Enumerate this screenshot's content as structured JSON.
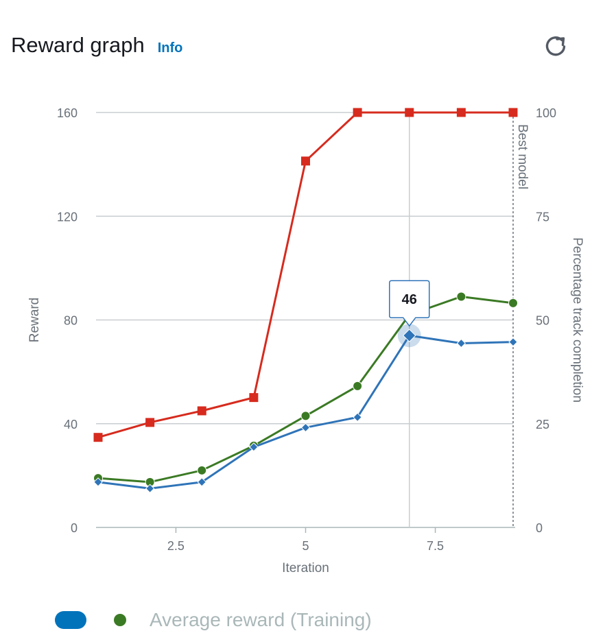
{
  "header": {
    "title": "Reward graph",
    "info_label": "Info",
    "refresh_icon": "refresh-icon"
  },
  "legend": {
    "series_label": "Average reward (Training)"
  },
  "chart_data": {
    "type": "line",
    "xlabel": "Iteration",
    "ylabel": "Reward",
    "ylabel_right": "Percentage track completion",
    "x_ticks": [
      "2.5",
      "5",
      "7.5"
    ],
    "y_ticks": [
      "0",
      "40",
      "80",
      "120",
      "160"
    ],
    "y_right_ticks": [
      "0",
      "25",
      "50",
      "75",
      "100"
    ],
    "xlim": [
      1,
      9
    ],
    "ylim": [
      0,
      160
    ],
    "ylim_right": [
      0,
      100
    ],
    "grid": true,
    "x": [
      1,
      2,
      3,
      4,
      5,
      6,
      7,
      8,
      9
    ],
    "series": [
      {
        "name": "Average reward (Training)",
        "axis": "left",
        "marker": "circle",
        "color": "#3b7a24",
        "values": [
          19,
          17.5,
          22,
          31.5,
          43,
          54.5,
          82,
          89,
          86.5
        ]
      },
      {
        "axis": "left",
        "marker": "diamond",
        "color": "#2f74b8",
        "values": [
          17.5,
          15,
          17.5,
          31,
          38.5,
          42.5,
          74,
          71,
          71.5
        ]
      },
      {
        "axis": "right",
        "marker": "square",
        "color": "#d62b1e",
        "values": [
          21.7,
          25.3,
          28.1,
          31.3,
          88.3,
          100,
          100,
          100,
          100
        ]
      }
    ],
    "best_model": {
      "label": "Best model",
      "x": 9
    },
    "hover": {
      "x": 7,
      "tooltip": "46"
    }
  }
}
